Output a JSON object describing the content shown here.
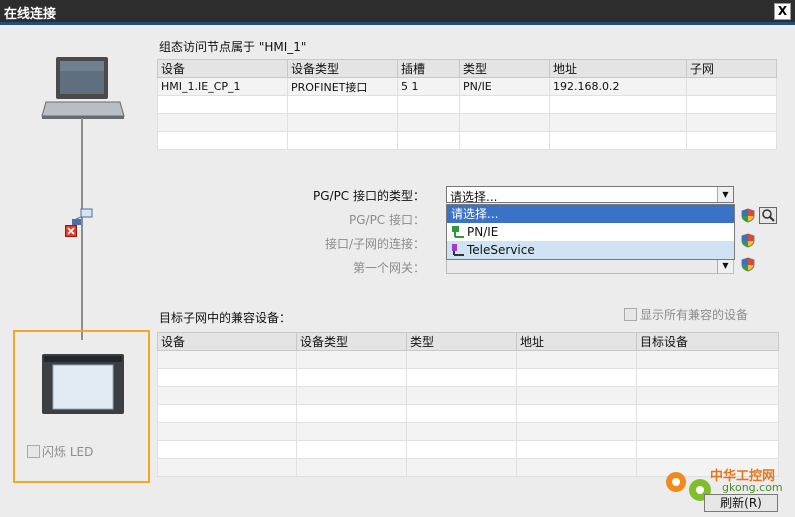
{
  "dialog": {
    "title": "在线连接",
    "close_glyph": "X"
  },
  "access_node_label": "组态访问节点属于 \"HMI_1\"",
  "nodes_table": {
    "headers": [
      "设备",
      "设备类型",
      "插槽",
      "类型",
      "地址",
      "子网"
    ],
    "rows": [
      [
        "HMI_1.IE_CP_1",
        "PROFINET接口",
        "5 1",
        "PN/IE",
        "192.168.0.2",
        ""
      ]
    ]
  },
  "form": {
    "pgpc_type_label": "PG/PC 接口的类型：",
    "pgpc_type_value": "请选择...",
    "pgpc_interface_label": "PG/PC 接口：",
    "subnet_conn_label": "接口/子网的连接：",
    "first_gateway_label": "第一个网关："
  },
  "dropdown": {
    "options": [
      {
        "label": "请选择...",
        "state": "selected"
      },
      {
        "label": "PN/IE",
        "state": "normal"
      },
      {
        "label": "TeleService",
        "state": "hover"
      }
    ]
  },
  "target_label": "目标子网中的兼容设备：",
  "show_all_label": "显示所有兼容的设备",
  "target_table": {
    "headers": [
      "设备",
      "设备类型",
      "类型",
      "地址",
      "目标设备"
    ]
  },
  "flash_led_label": "闪烁 LED",
  "refresh_button": "刷新(R)",
  "watermark": {
    "cn": "中华工控网",
    "url": "gkong.com"
  },
  "colors": {
    "accent_selection": "#3a72c8",
    "hover_row": "#cfe3f5",
    "highlight_box": "#f5a623",
    "titlebar": "#2d2d2d"
  }
}
